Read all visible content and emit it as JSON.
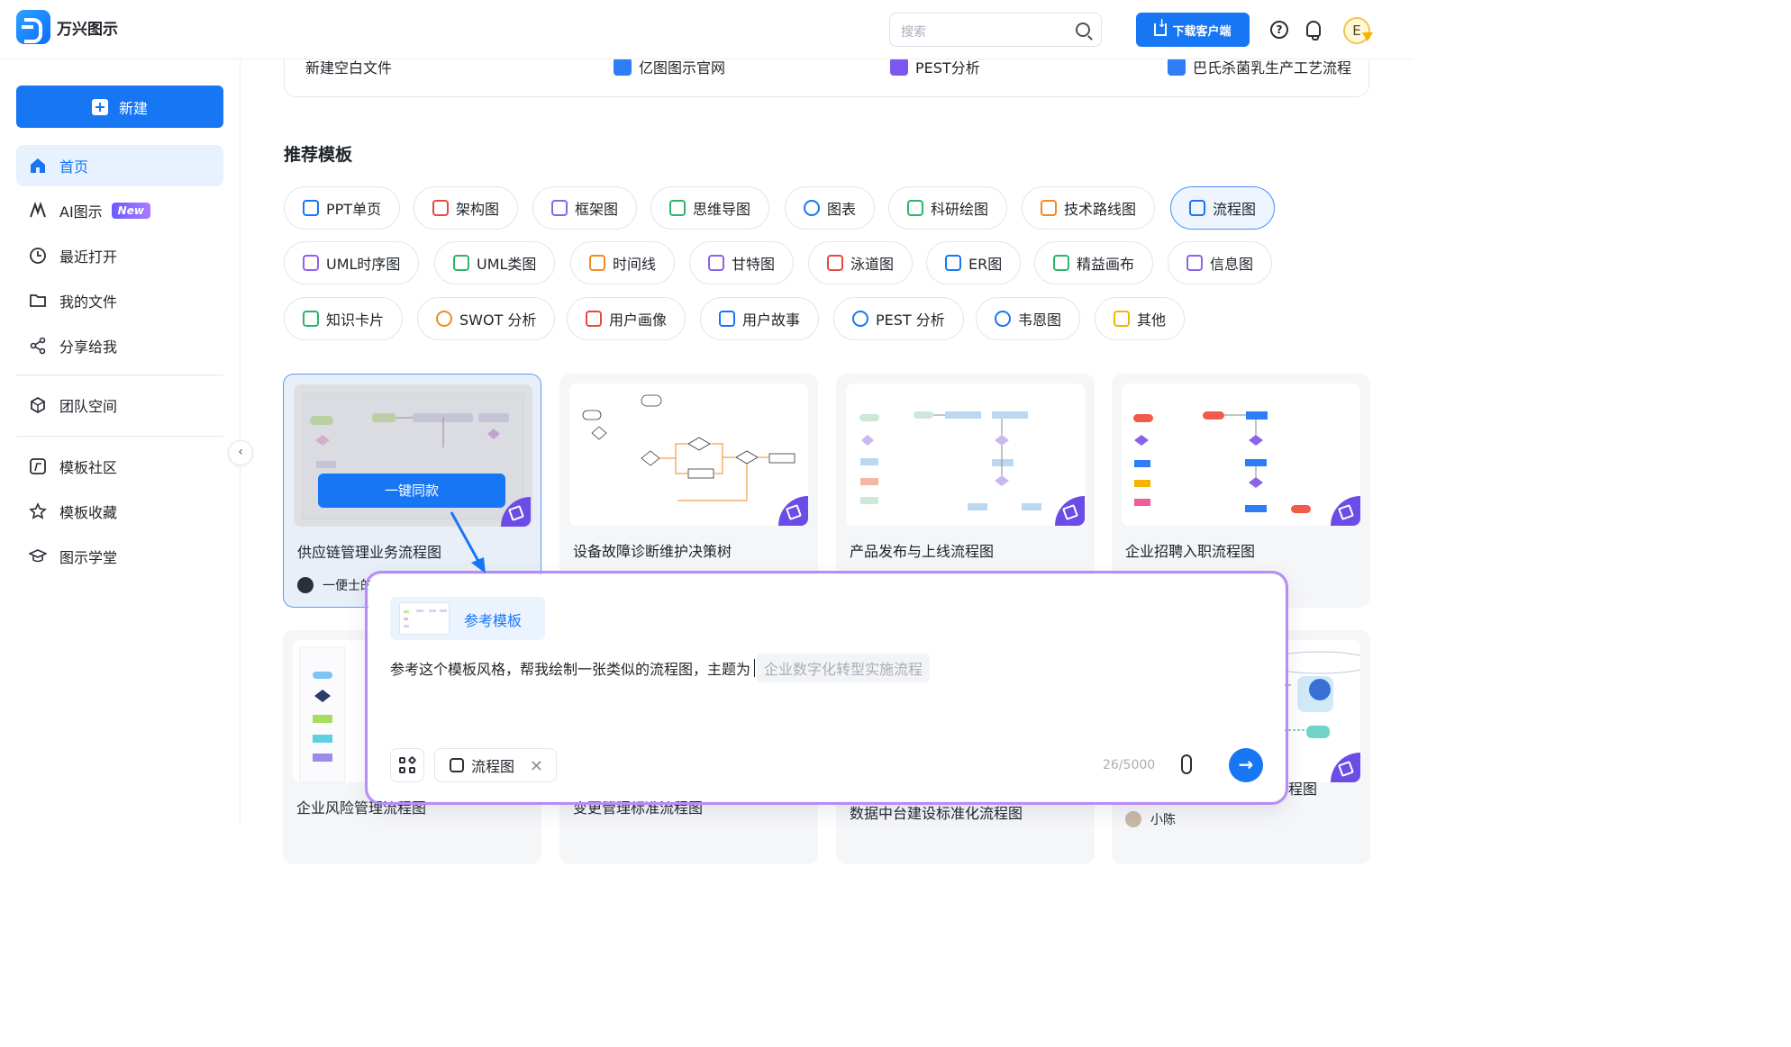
{
  "header": {
    "brand": "万兴图示",
    "search_placeholder": "搜索",
    "download_label": "下载客户端",
    "help_glyph": "?",
    "avatar_letter": "E"
  },
  "sidebar": {
    "new_label": "新建",
    "items": [
      {
        "label": "首页",
        "icon": "home-icon"
      },
      {
        "label": "AI图示",
        "icon": "ai-icon",
        "badge": "New"
      },
      {
        "label": "最近打开",
        "icon": "clock-icon"
      },
      {
        "label": "我的文件",
        "icon": "folder-icon"
      },
      {
        "label": "分享给我",
        "icon": "share-icon"
      },
      {
        "label": "团队空间",
        "icon": "team-icon"
      },
      {
        "label": "模板社区",
        "icon": "template-icon"
      },
      {
        "label": "模板收藏",
        "icon": "star-icon"
      },
      {
        "label": "图示学堂",
        "icon": "academy-icon"
      }
    ],
    "collapse_glyph": "‹"
  },
  "recent": {
    "items": [
      "新建空白文件",
      "亿图图示官网",
      "PEST分析",
      "巴氏杀菌乳生产工艺流程"
    ]
  },
  "templates": {
    "section_title": "推荐模板",
    "categories": [
      "PPT单页",
      "架构图",
      "框架图",
      "思维导图",
      "图表",
      "科研绘图",
      "技术路线图",
      "流程图",
      "UML时序图",
      "UML类图",
      "时间线",
      "甘特图",
      "泳道图",
      "ER图",
      "精益画布",
      "信息图",
      "知识卡片",
      "SWOT 分析",
      "用户画像",
      "用户故事",
      "PEST 分析",
      "韦恩图",
      "其他"
    ],
    "active_category": "流程图",
    "cards": [
      {
        "title": "供应链管理业务流程图",
        "author": "一便士的"
      },
      {
        "title": "设备故障诊断维护决策树"
      },
      {
        "title": "产品发布与上线流程图"
      },
      {
        "title": "企业招聘入职流程图"
      },
      {
        "title": "企业风险管理流程图"
      },
      {
        "title": "变更管理标准流程图"
      },
      {
        "title": "数据中台建设标准化流程图"
      },
      {
        "title": "程图",
        "author": "小陈"
      }
    ],
    "same_style_label": "一键同款"
  },
  "composer": {
    "ref_label": "参考模板",
    "prompt_text": "参考这个模板风格，帮我绘制一张类似的流程图，主题为",
    "topic_placeholder": "企业数字化转型实施流程",
    "type_chip": "流程图",
    "counter": "26/5000",
    "send_glyph": "→",
    "close_glyph": "✕"
  },
  "colors": {
    "primary": "#1776f4",
    "active_bg": "#e8f2fe",
    "ai_purple": "#6b4ce6"
  }
}
